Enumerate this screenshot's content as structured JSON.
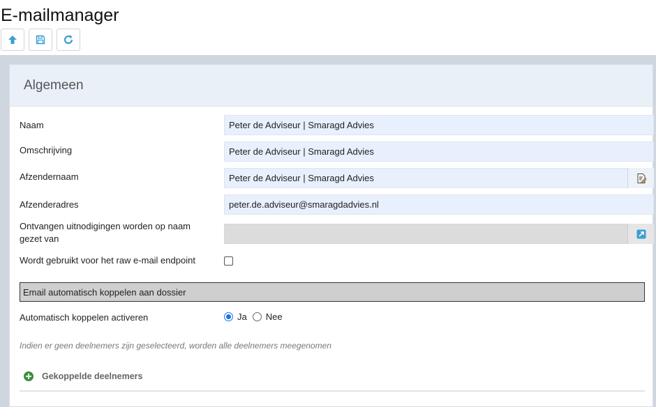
{
  "page": {
    "title": "E-mailmanager"
  },
  "toolbar": {
    "buttons": [
      {
        "icon": "arrow-up-icon"
      },
      {
        "icon": "save-icon"
      },
      {
        "icon": "refresh-icon"
      }
    ]
  },
  "panel": {
    "title": "Algemeen",
    "fields": {
      "naam": {
        "label": "Naam",
        "value": "Peter de Adviseur | Smaragd Advies"
      },
      "omschrijving": {
        "label": "Omschrijving",
        "value": "Peter de Adviseur | Smaragd Advies"
      },
      "afzendernaam": {
        "label": "Afzendernaam",
        "value": "Peter de Adviseur | Smaragd Advies",
        "button_icon": "edit-document-icon"
      },
      "afzenderadres": {
        "label": "Afzenderadres",
        "value": "peter.de.adviseur@smaragdadvies.nl"
      },
      "ontvangen": {
        "label": "Ontvangen uitnodigingen worden op naam gezet van",
        "value": "",
        "button_icon": "external-link-icon"
      },
      "raw_endpoint": {
        "label": "Wordt gebruikt voor het raw e-mail endpoint",
        "checked": false
      }
    },
    "section": {
      "title": "Email automatisch koppelen aan dossier",
      "auto_link": {
        "label": "Automatisch koppelen activeren",
        "options": [
          "Ja",
          "Nee"
        ],
        "selected": "Ja"
      },
      "hint": "Indien er geen deelnemers zijn geselecteerd, worden alle deelnemers meegenomen",
      "linked_participants": "Gekoppelde deelnemers"
    }
  },
  "colors": {
    "accent": "#3b9fd1",
    "field_bg": "#e8f0fe",
    "header_bg": "#eaf0f8",
    "add_icon": "#3a8f3a"
  }
}
